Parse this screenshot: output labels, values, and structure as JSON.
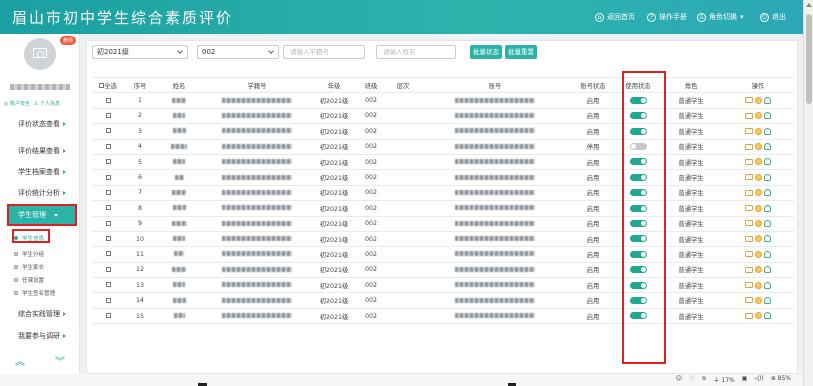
{
  "header": {
    "title": "眉山市初中学生综合素质评价",
    "home": "返回首页",
    "manual": "操作手册",
    "role_switch": "角色切换",
    "logout": "退出"
  },
  "sidebar": {
    "badge": "教师",
    "user_links": [
      "账户安全",
      "个人信息"
    ],
    "menu": [
      {
        "label": "评价状态查看"
      },
      {
        "label": "评价结果查看"
      },
      {
        "label": "学生档案查看"
      },
      {
        "label": "评价统计分析"
      }
    ],
    "active_menu": "学生管理",
    "sub_items": [
      {
        "label": "学生信息",
        "active": true
      },
      {
        "label": "学生分组",
        "active": false
      },
      {
        "label": "学生家长",
        "active": false
      },
      {
        "label": "任课设置",
        "active": false
      },
      {
        "label": "学生签名管理",
        "active": false
      }
    ],
    "menu_bottom": [
      {
        "label": "综合实践管理"
      },
      {
        "label": "我要参与调研"
      }
    ]
  },
  "filters": {
    "grade": "初2021级",
    "class": "002",
    "student_no_placeholder": "请输入学籍号",
    "name_placeholder": "请输入姓名",
    "batch_status": "批量状态",
    "batch_reset": "批量重置"
  },
  "table": {
    "headers": [
      "全选",
      "序号",
      "姓名",
      "学籍号",
      "年级",
      "班级",
      "层次",
      "账号",
      "账号状态",
      "使用状态",
      "角色",
      "操作"
    ],
    "rows": [
      {
        "no": "1",
        "grade": "初2021级",
        "class": "002",
        "acct_status": "启用",
        "use_on": true,
        "role": "普通学生"
      },
      {
        "no": "2",
        "grade": "初2021级",
        "class": "002",
        "acct_status": "启用",
        "use_on": true,
        "role": "普通学生"
      },
      {
        "no": "3",
        "grade": "初2021级",
        "class": "002",
        "acct_status": "启用",
        "use_on": true,
        "role": "普通学生"
      },
      {
        "no": "4",
        "grade": "初2021级",
        "class": "002",
        "acct_status": "停用",
        "use_on": false,
        "role": "普通学生"
      },
      {
        "no": "5",
        "grade": "初2021级",
        "class": "002",
        "acct_status": "启用",
        "use_on": true,
        "role": "普通学生"
      },
      {
        "no": "6",
        "grade": "初2021级",
        "class": "002",
        "acct_status": "启用",
        "use_on": true,
        "role": "普通学生"
      },
      {
        "no": "7",
        "grade": "初2021级",
        "class": "002",
        "acct_status": "启用",
        "use_on": true,
        "role": "普通学生"
      },
      {
        "no": "8",
        "grade": "初2021级",
        "class": "002",
        "acct_status": "启用",
        "use_on": true,
        "role": "普通学生"
      },
      {
        "no": "9",
        "grade": "初2021级",
        "class": "002",
        "acct_status": "启用",
        "use_on": true,
        "role": "普通学生"
      },
      {
        "no": "10",
        "grade": "初2021级",
        "class": "002",
        "acct_status": "启用",
        "use_on": true,
        "role": "普通学生"
      },
      {
        "no": "11",
        "grade": "初2021级",
        "class": "002",
        "acct_status": "启用",
        "use_on": true,
        "role": "普通学生"
      },
      {
        "no": "12",
        "grade": "初2021级",
        "class": "002",
        "acct_status": "启用",
        "use_on": true,
        "role": "普通学生"
      },
      {
        "no": "13",
        "grade": "初2021级",
        "class": "002",
        "acct_status": "启用",
        "use_on": true,
        "role": "普通学生"
      },
      {
        "no": "14",
        "grade": "初2021级",
        "class": "002",
        "acct_status": "启用",
        "use_on": true,
        "role": "普通学生"
      },
      {
        "no": "15",
        "grade": "初2021级",
        "class": "002",
        "acct_status": "启用",
        "use_on": true,
        "role": "普通学生"
      }
    ]
  },
  "taskbar": {
    "battery": "17%",
    "zoom": "85%"
  },
  "colors": {
    "header": "#1aa0a2",
    "accent": "#2bb3a8",
    "toggle_on": "#1fa88e",
    "highlight": "#e02020"
  }
}
